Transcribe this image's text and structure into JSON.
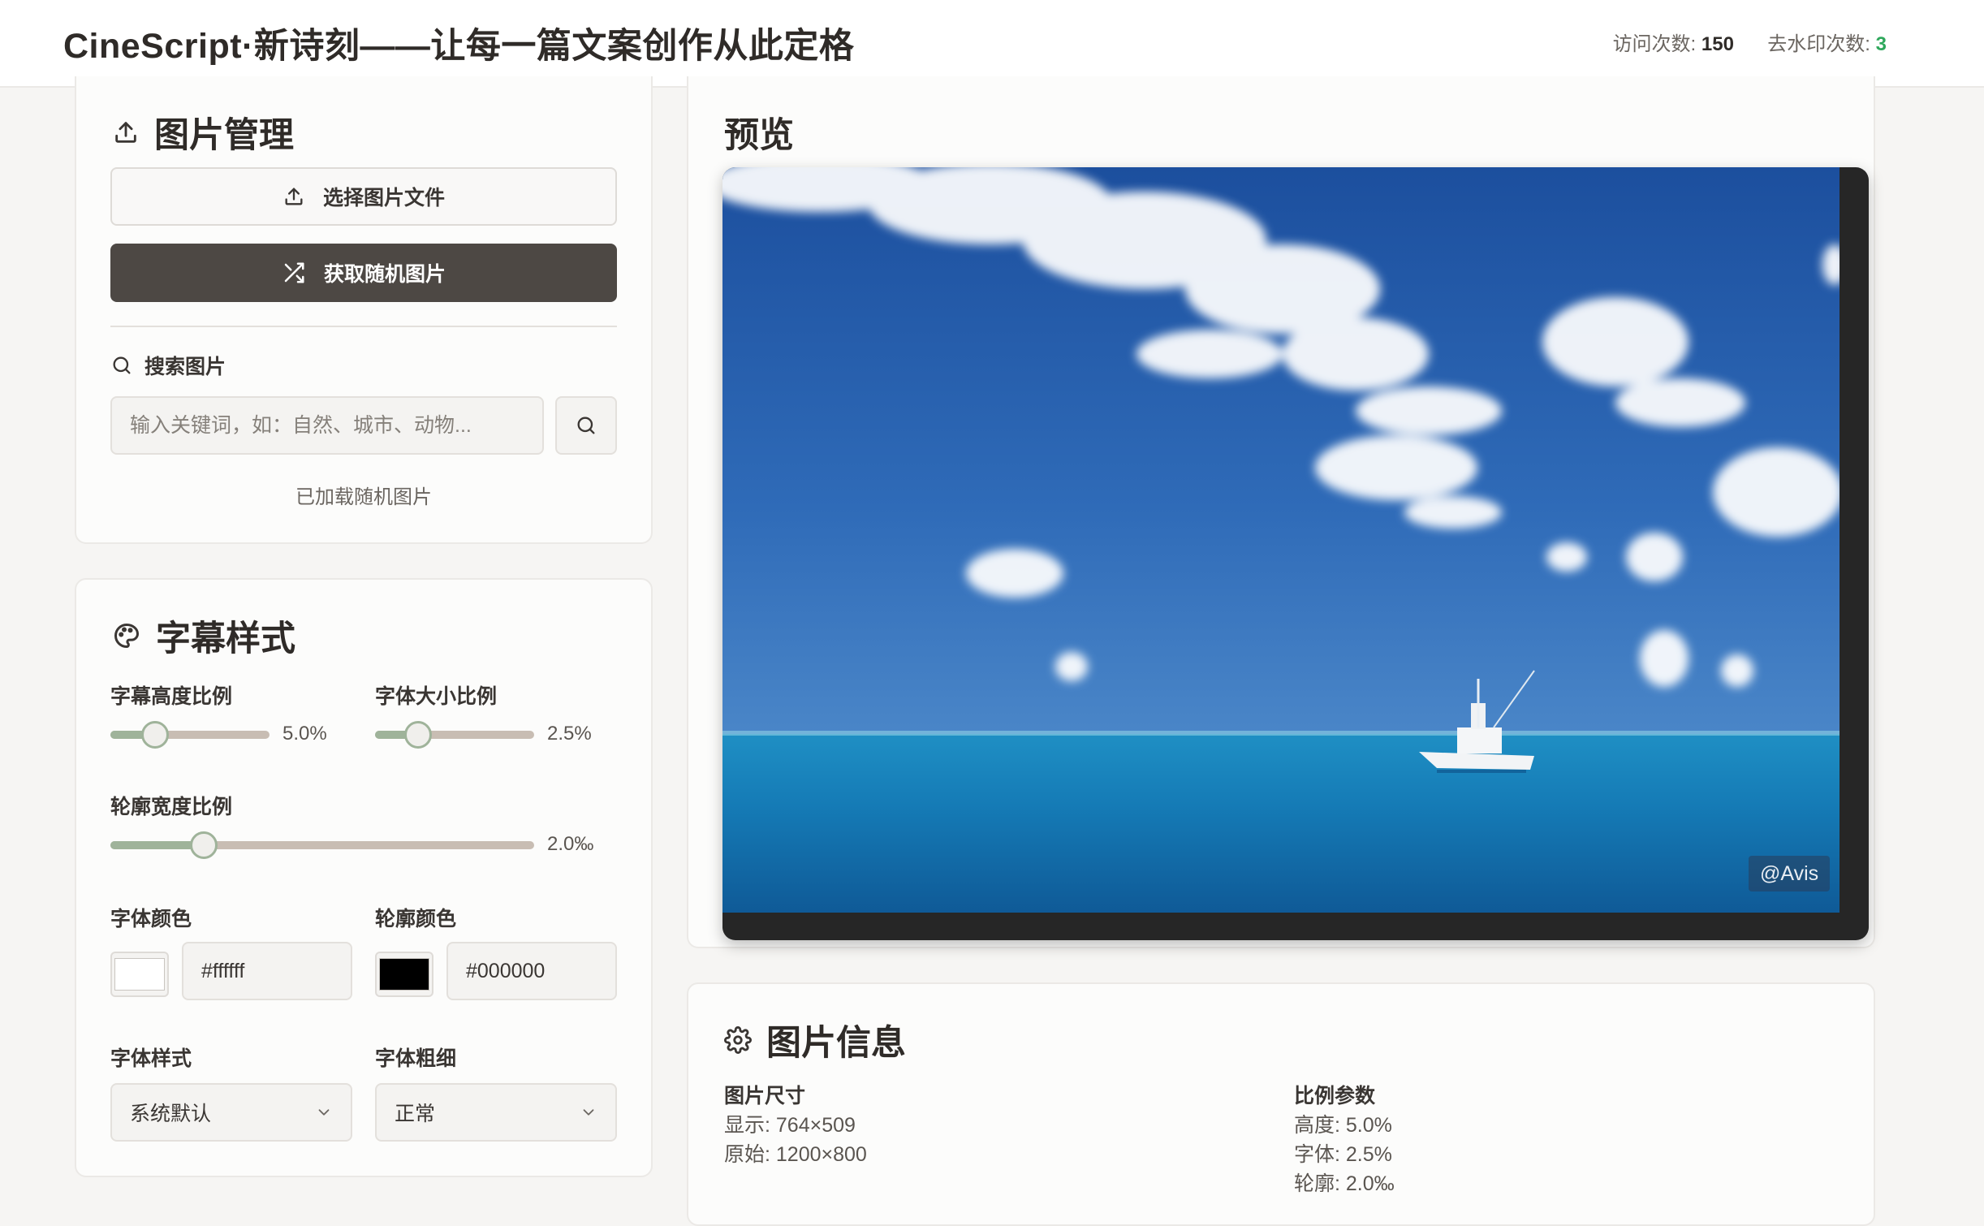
{
  "header": {
    "title": "CineScript·新诗刻——让每一篇文案创作从此定格",
    "visits_label": "访问次数:",
    "visits_value": "150",
    "dewatermark_label": "去水印次数:",
    "dewatermark_value": "3"
  },
  "image_mgmt": {
    "title": "图片管理",
    "upload_label": "选择图片文件",
    "random_label": "获取随机图片",
    "search_label": "搜索图片",
    "search_placeholder": "输入关键词，如：自然、城市、动物...",
    "status": "已加载随机图片"
  },
  "subtitle_style": {
    "title": "字幕样式",
    "height_ratio": {
      "label": "字幕高度比例",
      "value_text": "5.0%",
      "fraction": 0.28
    },
    "font_size_ratio": {
      "label": "字体大小比例",
      "value_text": "2.5%",
      "fraction": 0.27
    },
    "outline_width_ratio": {
      "label": "轮廓宽度比例",
      "value_text": "2.0‰",
      "fraction": 0.22
    },
    "font_color": {
      "label": "字体颜色",
      "hex": "#ffffff"
    },
    "outline_color": {
      "label": "轮廓颜色",
      "hex": "#000000"
    },
    "font_style": {
      "label": "字体样式",
      "selected": "系统默认"
    },
    "font_weight": {
      "label": "字体粗细",
      "selected": "正常"
    }
  },
  "preview": {
    "title": "预览",
    "watermark": "@Avis"
  },
  "image_info": {
    "title": "图片信息",
    "size_heading": "图片尺寸",
    "display": "显示: 764×509",
    "original": "原始: 1200×800",
    "ratio_heading": "比例参数",
    "height": "高度: 5.0%",
    "font": "字体: 2.5%",
    "outline": "轮廓: 2.0‰"
  },
  "colors": {
    "accent_dark": "#4d4844",
    "slider_fill": "#9fb39a",
    "slider_track": "#c8bdb3",
    "green": "#2fa85c"
  }
}
